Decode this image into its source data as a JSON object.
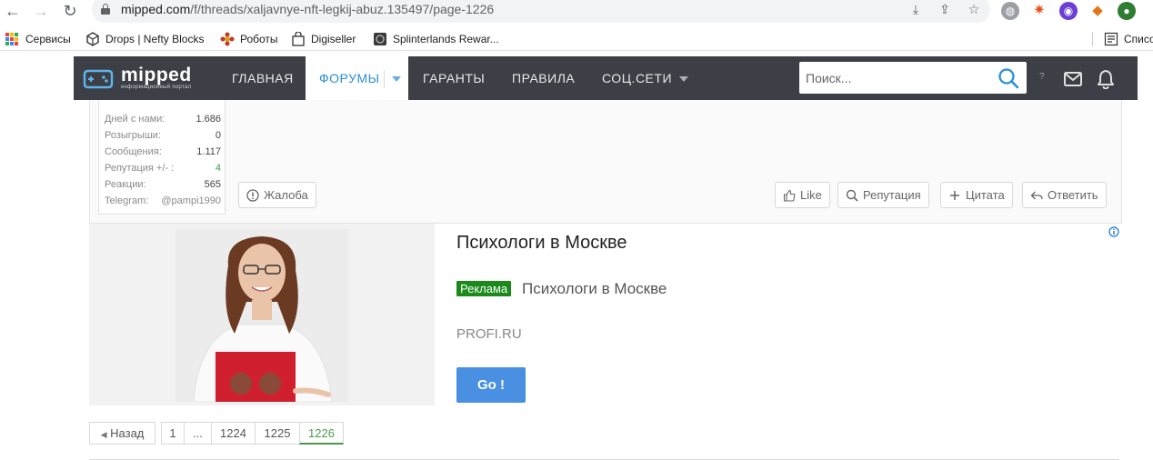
{
  "browser": {
    "url_host": "mipped.com",
    "url_path": "/f/threads/xaljavnye-nft-legkij-abuz.135497/page-1226",
    "bookmarks": [
      {
        "label": "Сервисы"
      },
      {
        "label": "Drops | Nefty Blocks"
      },
      {
        "label": "Роботы"
      },
      {
        "label": "Digiseller"
      },
      {
        "label": "Splinterlands Rewar..."
      }
    ],
    "reading_list_label": "Списо"
  },
  "site": {
    "logo_text": "mipped",
    "logo_subtext": "информационный портал",
    "nav": [
      {
        "label": "ГЛАВНАЯ"
      },
      {
        "label": "ФОРУМЫ"
      },
      {
        "label": "ГАРАНТЫ"
      },
      {
        "label": "ПРАВИЛА"
      },
      {
        "label": "СОЦ.СЕТИ"
      }
    ],
    "search_placeholder": "Поиск...",
    "help_label": "?"
  },
  "post": {
    "stats": [
      {
        "label": "Дней с нами:",
        "value": "1.686"
      },
      {
        "label": "Розыгрыши:",
        "value": "0"
      },
      {
        "label": "Сообщения:",
        "value": "1.117"
      },
      {
        "label": "Репутация +/- :",
        "value": "4"
      },
      {
        "label": "Реакции:",
        "value": "565"
      },
      {
        "label": "Telegram:",
        "value": "@pampi1990"
      }
    ],
    "report_label": "Жалоба",
    "like_label": "Like",
    "reputation_label": "Репутация",
    "quote_label": "Цитата",
    "reply_label": "Ответить"
  },
  "ad": {
    "title": "Психологи в Москве",
    "badge": "Реклама",
    "description": "Психологи в Москве",
    "domain": "PROFI.RU",
    "cta": "Go !"
  },
  "pagination": {
    "prev_label": "Назад",
    "pages": [
      "1",
      "...",
      "1224",
      "1225",
      "1226"
    ],
    "current": "1226"
  },
  "colors": {
    "header_bg": "#3c3f45",
    "accent_blue": "#2b8fd6",
    "ad_badge_green": "#1b8a1b",
    "cta_blue": "#4a90e2",
    "current_page_green": "#4a9a4a"
  }
}
